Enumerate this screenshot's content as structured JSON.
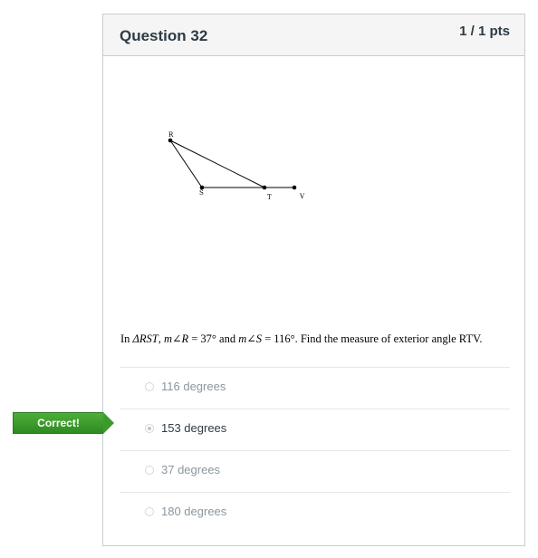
{
  "question": {
    "title": "Question 32",
    "points": "1 / 1 pts",
    "figure": {
      "labels": {
        "R": "R",
        "S": "S",
        "T": "T",
        "V": "V"
      }
    },
    "text": {
      "prefix": "In ",
      "triangle": "ΔRST",
      "sep1": ", ",
      "angle_r": "m∠R",
      "value_r": " = 37° and ",
      "angle_s": "m∠S",
      "value_s": " = 116°. Find the measure of exterior angle RTV."
    },
    "answers": [
      {
        "label": "116 degrees",
        "selected": false
      },
      {
        "label": "153 degrees",
        "selected": true
      },
      {
        "label": "37 degrees",
        "selected": false
      },
      {
        "label": "180 degrees",
        "selected": false
      }
    ]
  },
  "feedback": {
    "correct_label": "Correct!"
  },
  "colors": {
    "correct_green": "#3c9b2c",
    "border": "#c7cdd1",
    "header_bg": "#f5f5f5"
  }
}
